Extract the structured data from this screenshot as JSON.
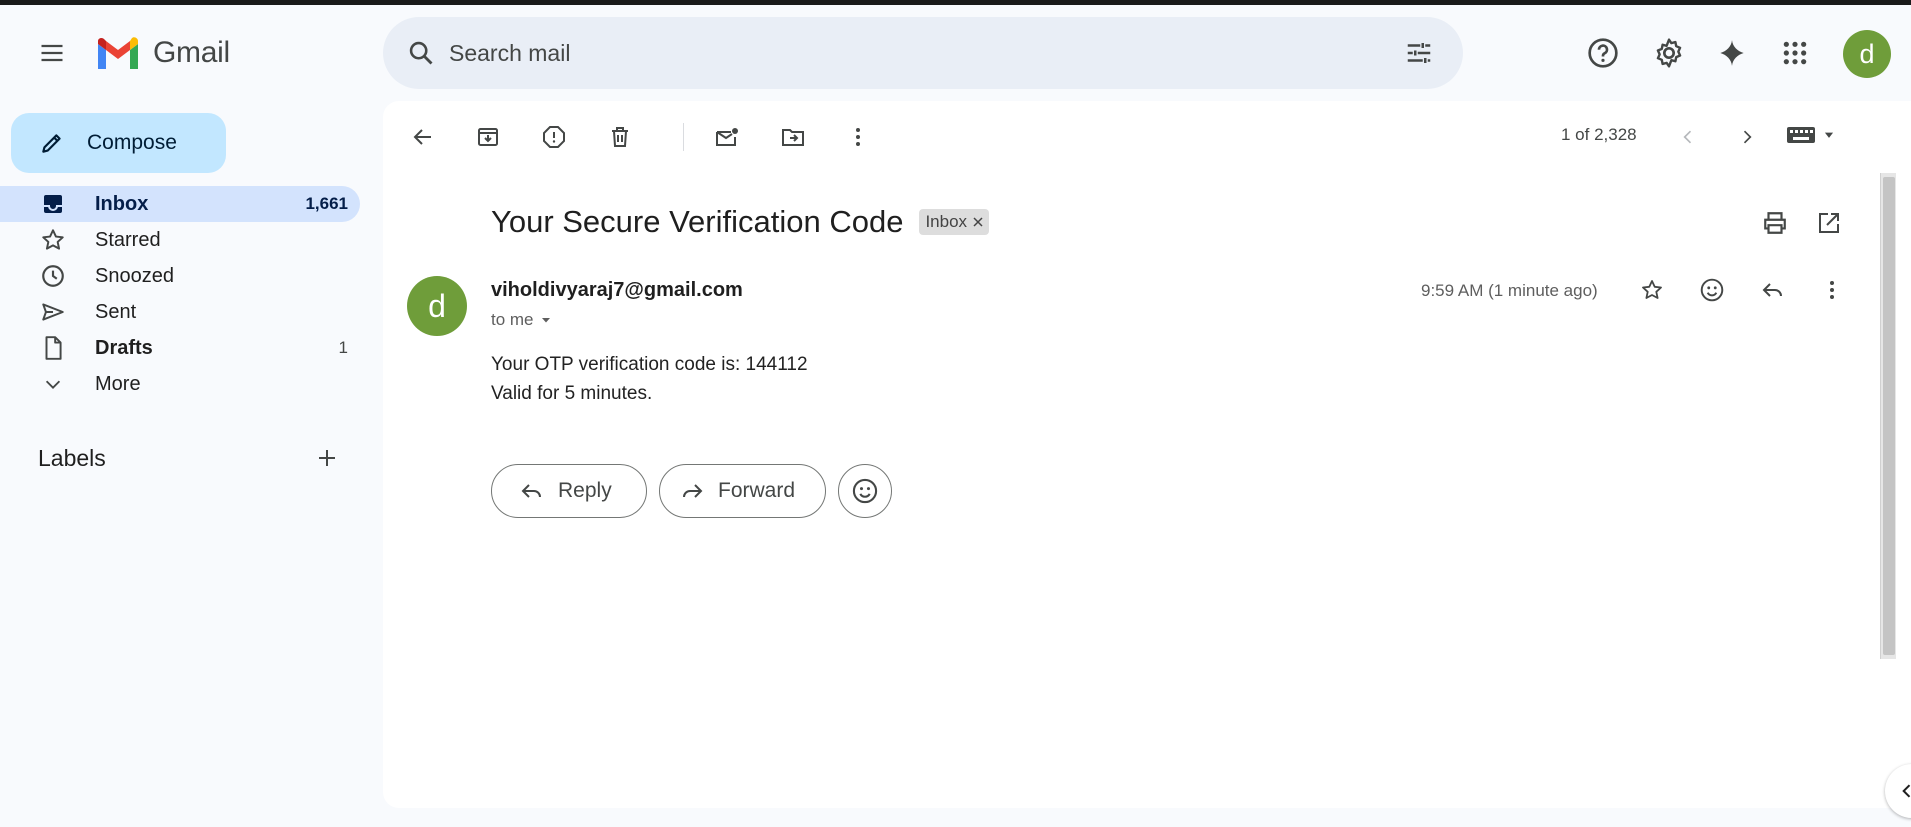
{
  "app": {
    "name": "Gmail",
    "avatar_letter": "d"
  },
  "search": {
    "placeholder": "Search mail"
  },
  "sidebar": {
    "compose_label": "Compose",
    "items": [
      {
        "label": "Inbox",
        "count": "1,661",
        "icon": "inbox-icon"
      },
      {
        "label": "Starred",
        "count": "",
        "icon": "star-icon"
      },
      {
        "label": "Snoozed",
        "count": "",
        "icon": "clock-icon"
      },
      {
        "label": "Sent",
        "count": "",
        "icon": "send-icon"
      },
      {
        "label": "Drafts",
        "count": "1",
        "icon": "draft-icon"
      },
      {
        "label": "More",
        "count": "",
        "icon": "chevron-down-icon"
      }
    ],
    "labels_heading": "Labels"
  },
  "toolbar": {
    "pager_text": "1 of 2,328"
  },
  "email": {
    "subject": "Your Secure Verification Code",
    "label_chip": "Inbox",
    "sender_avatar_letter": "d",
    "sender": "viholdivyaraj7@gmail.com",
    "recipient": "to me",
    "time": "9:59 AM (1 minute ago)",
    "body_lines": [
      "Your OTP verification code is: 144112",
      "Valid for 5 minutes."
    ]
  },
  "actions": {
    "reply_label": "Reply",
    "forward_label": "Forward"
  },
  "colors": {
    "compose_bg": "#c2e7ff",
    "active_nav_bg": "#d3e3fd",
    "avatar_bg": "#6f9d3a",
    "search_bg": "#e9eef6"
  }
}
